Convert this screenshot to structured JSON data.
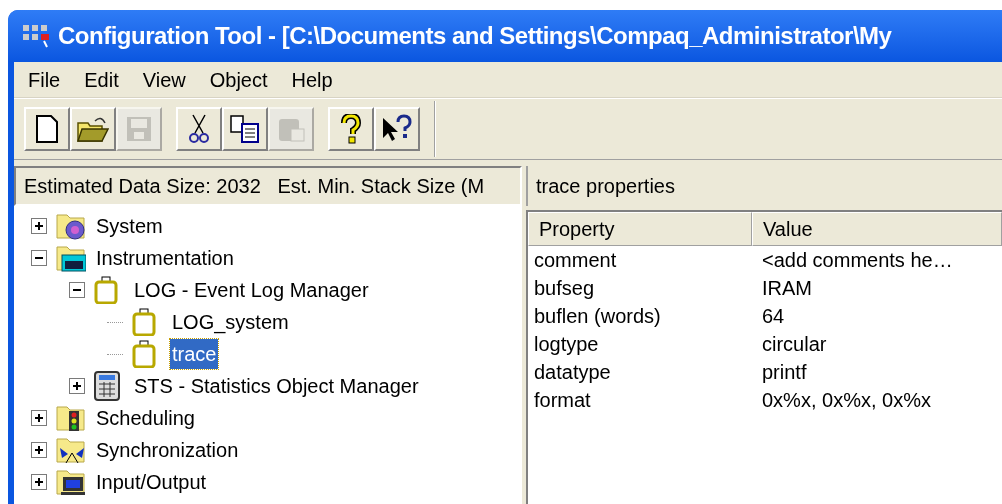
{
  "window": {
    "title": "Configuration Tool - [C:\\Documents and Settings\\Compaq_Administrator\\My"
  },
  "menu": [
    "File",
    "Edit",
    "View",
    "Object",
    "Help"
  ],
  "toolbar": [
    [
      {
        "kind": "new",
        "disabled": false
      },
      {
        "kind": "open",
        "disabled": false
      },
      {
        "kind": "save",
        "disabled": true
      }
    ],
    [
      {
        "kind": "cut",
        "disabled": false
      },
      {
        "kind": "copy",
        "disabled": false
      },
      {
        "kind": "paste",
        "disabled": true
      }
    ],
    [
      {
        "kind": "help",
        "disabled": false
      },
      {
        "kind": "contexthelp",
        "disabled": false
      }
    ]
  ],
  "tree_panel": {
    "header": "Estimated Data Size: 2032   Est. Min. Stack Size (M",
    "items": [
      {
        "label": "System",
        "kind": "system",
        "expanded": false,
        "selected": false
      },
      {
        "label": "Instrumentation",
        "kind": "instrumentation",
        "expanded": true,
        "selected": false,
        "children": [
          {
            "label": "LOG - Event Log Manager",
            "kind": "module",
            "expanded": true,
            "selected": false,
            "children": [
              {
                "label": "LOG_system",
                "kind": "object",
                "selected": false
              },
              {
                "label": "trace",
                "kind": "object",
                "selected": true
              }
            ]
          },
          {
            "label": "STS - Statistics Object Manager",
            "kind": "statistics",
            "expanded": false,
            "selected": false
          }
        ]
      },
      {
        "label": "Scheduling",
        "kind": "scheduling",
        "expanded": false,
        "selected": false
      },
      {
        "label": "Synchronization",
        "kind": "synchronization",
        "expanded": false,
        "selected": false
      },
      {
        "label": "Input/Output",
        "kind": "io",
        "expanded": false,
        "selected": false
      }
    ]
  },
  "properties_panel": {
    "header": "trace properties",
    "columns": [
      "Property",
      "Value"
    ],
    "rows": [
      {
        "property": "comment",
        "value": "<add comments he…"
      },
      {
        "property": "bufseg",
        "value": "IRAM"
      },
      {
        "property": "buflen (words)",
        "value": "64"
      },
      {
        "property": "logtype",
        "value": "circular"
      },
      {
        "property": "datatype",
        "value": "printf"
      },
      {
        "property": "format",
        "value": "0x%x, 0x%x, 0x%x"
      }
    ]
  }
}
